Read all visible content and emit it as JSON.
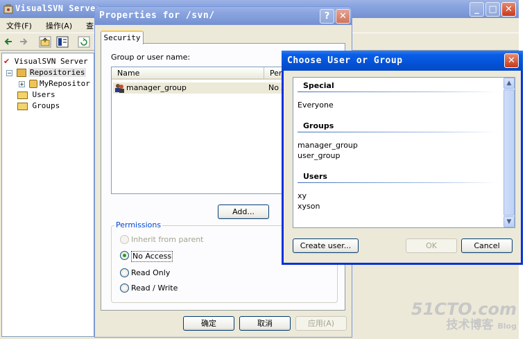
{
  "main_window": {
    "title": "VisualSVN Server",
    "menu": [
      "文件(F)",
      "操作(A)",
      "查"
    ],
    "tree": {
      "root": "VisualSVN Server",
      "repositories": "Repositories",
      "repo_child": "MyRepositor",
      "users": "Users",
      "groups": "Groups"
    }
  },
  "properties_dialog": {
    "title": "Properties for /svn/",
    "tab": "Security",
    "group_label": "Group or user name:",
    "columns": [
      "Name",
      "Per"
    ],
    "rows": [
      {
        "name": "manager_group",
        "permission": "No A"
      }
    ],
    "add_button": "Add...",
    "permissions_label": "Permissions",
    "options": [
      {
        "label": "Inherit from parent",
        "checked": false,
        "disabled": true
      },
      {
        "label": "No Access",
        "checked": true,
        "disabled": false
      },
      {
        "label": "Read Only",
        "checked": false,
        "disabled": false
      },
      {
        "label": "Read / Write",
        "checked": false,
        "disabled": false
      }
    ],
    "ok_button": "确定",
    "cancel_button": "取消",
    "apply_button": "应用(A)"
  },
  "chooser_dialog": {
    "title": "Choose User or Group",
    "sections": [
      {
        "heading": "Special",
        "items": [
          "Everyone"
        ]
      },
      {
        "heading": "Groups",
        "items": [
          "manager_group",
          "user_group"
        ]
      },
      {
        "heading": "Users",
        "items": [
          "xy",
          "xyson"
        ]
      }
    ],
    "create_user_button": "Create user...",
    "ok_button": "OK",
    "cancel_button": "Cancel"
  },
  "watermark": {
    "line1": "51CTO.com",
    "line2": "技术博客",
    "line3": "Blog"
  }
}
